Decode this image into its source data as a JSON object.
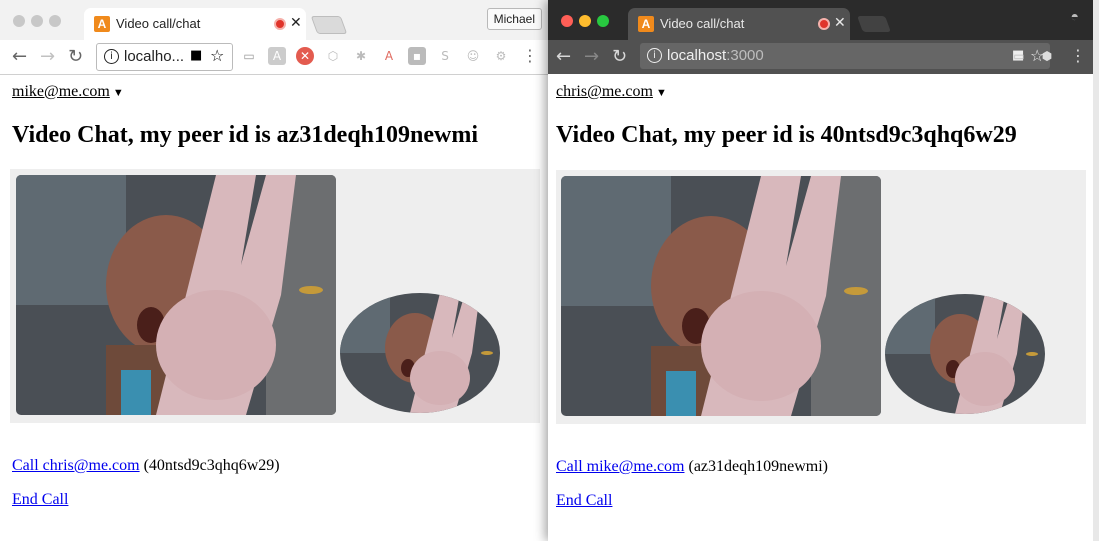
{
  "left_window": {
    "tab": {
      "favicon": "A",
      "title": "Video call/chat"
    },
    "profile_button": "Michael",
    "address": {
      "host": "localho...",
      "port": ""
    },
    "page": {
      "user_menu": "mike@me.com",
      "heading": "Video Chat, my peer id is az31deqh109newmi",
      "call_link_text": "Call chris@me.com",
      "call_peer_id": "(40ntsd9c3qhq6w29)",
      "end_call": "End Call"
    }
  },
  "right_window": {
    "tab": {
      "favicon": "A",
      "title": "Video call/chat"
    },
    "address": {
      "host": "localhost",
      "port": ":3000"
    },
    "page": {
      "user_menu": "chris@me.com",
      "heading": "Video Chat, my peer id is 40ntsd9c3qhq6w29",
      "call_link_text": "Call mike@me.com",
      "call_peer_id": "(az31deqh109newmi)",
      "end_call": "End Call"
    }
  },
  "icons": {
    "back": "back-arrow-icon",
    "forward": "forward-arrow-icon",
    "reload": "reload-icon",
    "info": "info-icon",
    "camera": "camera-icon",
    "bookmark": "star-icon",
    "menu": "kebab-menu-icon",
    "recording": "recording-icon",
    "close": "close-icon"
  },
  "colors": {
    "link": "#0000ee",
    "video_area_bg": "#eeeeee",
    "dark_chrome": "#2b2b2b",
    "dark_toolbar": "#515151",
    "favicon": "#f08a1c",
    "traffic_close": "#ff5f57",
    "traffic_min": "#febc2e",
    "traffic_max": "#28c840"
  }
}
